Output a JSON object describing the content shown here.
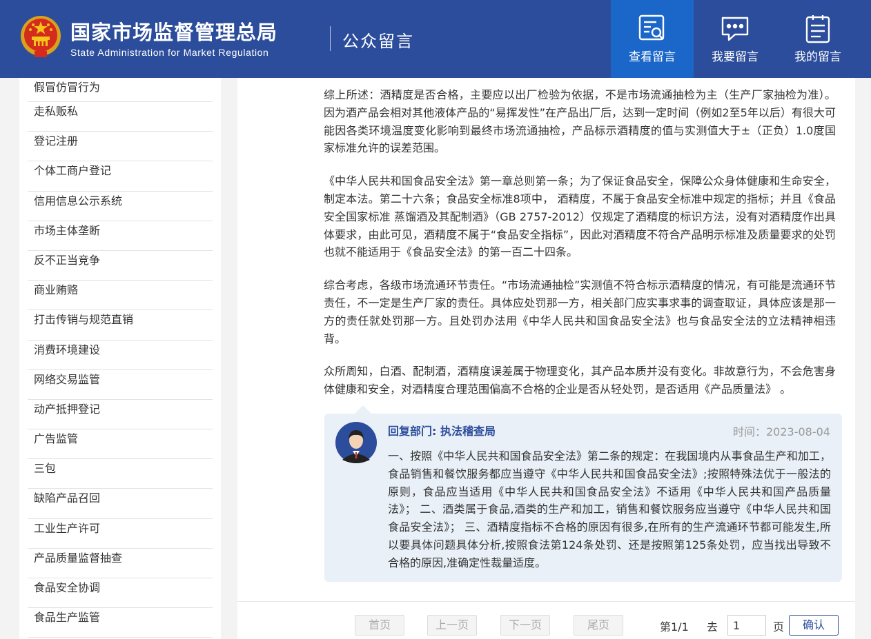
{
  "header": {
    "cn_title": "国家市场监督管理总局",
    "en_title": "State Administration for Market Regulation",
    "section": "公众留言",
    "nav": [
      {
        "label": "查看留言",
        "icon": "view-message-icon",
        "active": true
      },
      {
        "label": "我要留言",
        "icon": "chat-bubble-icon",
        "active": false
      },
      {
        "label": "我的留言",
        "icon": "clipboard-list-icon",
        "active": false
      }
    ]
  },
  "colors": {
    "header_bg": "#2c4d9b",
    "nav_active": "#1a67c9",
    "reply_bg": "#e9f0f8"
  },
  "sidebar": {
    "items": [
      "假冒仿冒行为",
      "走私贩私",
      "登记注册",
      "个体工商户登记",
      "信用信息公示系统",
      "市场主体垄断",
      "反不正当竞争",
      "商业贿赂",
      "打击传销与规范直销",
      "消费环境建设",
      "网络交易监管",
      "动产抵押登记",
      "广告监管",
      "三包",
      "缺陷产品召回",
      "工业生产许可",
      "产品质量监督抽查",
      "食品安全协调",
      "食品生产监管"
    ]
  },
  "message": {
    "paragraphs": [
      "综上所述：酒精度是否合格，主要应以出厂检验为依据，不是市场流通抽检为主（生产厂家抽检为准）。因为酒产品会相对其他液体产品的“易挥发性”在产品出厂后，达到一定时间（例如2至5年以后）有很大可能因各类环境温度变化影响到最终市场流通抽检，产品标示酒精度的值与实测值大于±（正负）1.0度国家标准允许的误差范围。",
      "《中华人民共和国食品安全法》第一章总则第一条；为了保证食品安全，保障公众身体健康和生命安全，制定本法。第二十六条；食品安全标准8项中， 酒精度，不属于食品安全标准中规定的指标；并且《食品安全国家标准 蒸馏酒及其配制酒》（GB 2757-2012）仅规定了酒精度的标识方法，没有对酒精度作出具体要求，由此可见，酒精度不属于“食品安全指标”，因此对酒精度不符合产品明示标准及质量要求的处罚也就不能适用于《食品安全法》的第一百二十四条。",
      "综合考虑，各级市场流通环节责任。“市场流通抽检”实测值不符合标示酒精度的情况，有可能是流通环节责任，不一定是生产厂家的责任。具体应处罚那一方，相关部门应实事求事的调查取证，具体应该是那一方的责任就处罚那一方。且处罚办法用《中华人民共和国食品安全法》也与食品安全法的立法精神相违背。",
      "众所周知，白酒、配制酒，酒精度误差属于物理变化，其产品本质并没有变化。非故意行为，不会危害身体健康和安全，对酒精度合理范围偏高不合格的企业是否从轻处罚，是否适用《产品质量法》 。"
    ]
  },
  "reply": {
    "dept": "回复部门: 执法稽查局",
    "time": "时间：2023-08-04",
    "text": "一、按照《中华人民共和国食品安全法》第二条的规定：在我国境内从事食品生产和加工，食品销售和餐饮服务都应当遵守《中华人民共和国食品安全法》;按照特殊法优于一般法的原则，食品应当适用《中华人民共和国食品安全法》不适用《中华人民共和国产品质量法》； 二、酒类属于食品,酒类的生产和加工，销售和餐饮服务应当遵守《中华人民共和国食品安全法》； 三、酒精度指标不合格的原因有很多,在所有的生产流通环节都可能发生,所以要具体问题具体分析,按照食法第124条处罚、还是按照第125条处罚，应当找出导致不合格的原因,准确定性裁量适度。"
  },
  "pager": {
    "first": "首页",
    "prev": "上一页",
    "next": "下一页",
    "last": "尾页",
    "page_info": "第1/1",
    "goto": "去",
    "page_value": "1",
    "page_unit": "页",
    "confirm": "确认"
  }
}
